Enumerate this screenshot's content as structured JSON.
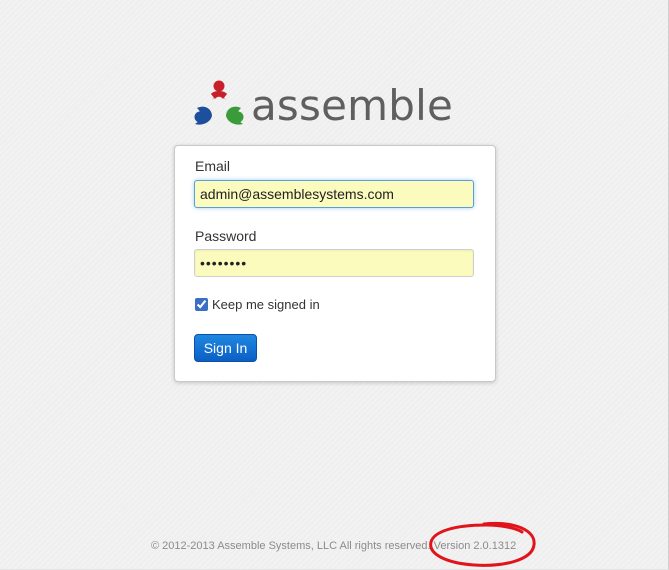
{
  "brand": {
    "name": "assemble",
    "colors": {
      "red": "#c8202a",
      "blue": "#1d4f9c",
      "green": "#3a9b3a"
    }
  },
  "login": {
    "email_label": "Email",
    "email_value": "admin@assemblesystems.com",
    "password_label": "Password",
    "password_value": "••••••••",
    "remember_label": "Keep me signed in",
    "remember_checked": true,
    "signin_label": "Sign In"
  },
  "footer": {
    "copyright": "© 2012-2013 Assemble Systems, LLC All rights reserved. Version 2.0.1312"
  },
  "colors": {
    "field_background": "#fafbbd",
    "button": "#0b5fc6",
    "annotation": "#e0141b"
  }
}
